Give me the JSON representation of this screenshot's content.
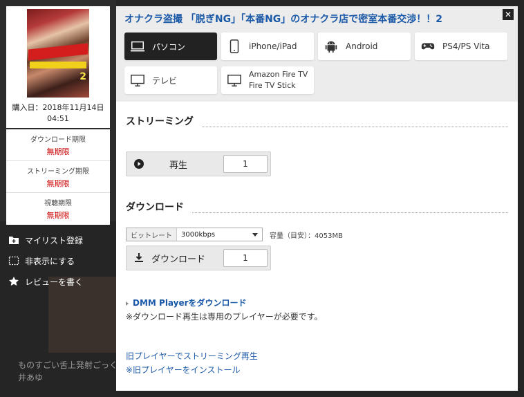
{
  "left": {
    "purchase_date": "購入日：2018年11月14日 04:51",
    "cover_number": "2",
    "periods": [
      {
        "label": "ダウンロード期限",
        "value": "無期限"
      },
      {
        "label": "ストリーミング期限",
        "value": "無期限"
      },
      {
        "label": "視聴期限",
        "value": "無期限"
      }
    ],
    "actions": [
      {
        "label": "マイリスト登録",
        "icon": "folder-plus-icon"
      },
      {
        "label": "非表示にする",
        "icon": "dotted-square-icon"
      },
      {
        "label": "レビューを書く",
        "icon": "star-icon"
      }
    ],
    "bg_text_1": "ものすごい舌上発射ごっくん",
    "bg_text_2": "井あゆ"
  },
  "modal": {
    "title": "オナクラ盗撮 「脱ぎNG」「本番NG」のオナクラ店で密室本番交渉！！2",
    "close_label": "✕",
    "devices": [
      {
        "label": "パソコン",
        "icon": "laptop-icon",
        "active": true
      },
      {
        "label": "iPhone/iPad",
        "icon": "phone-icon",
        "active": false
      },
      {
        "label": "Android",
        "icon": "android-icon",
        "active": false
      },
      {
        "label": "PS4/PS Vita",
        "icon": "gamepad-icon",
        "active": false
      },
      {
        "label": "テレビ",
        "icon": "tv-icon",
        "active": false
      },
      {
        "label": "Amazon Fire TV",
        "label2": "Fire TV Stick",
        "icon": "monitor-icon",
        "active": false
      }
    ],
    "streaming": {
      "heading": "ストリーミング",
      "play_label": "再生",
      "play_count": "1"
    },
    "download": {
      "heading": "ダウンロード",
      "bitrate_key": "ビットレート",
      "bitrate_value": "3000kbps",
      "capacity": "容量（目安）：4053MB",
      "download_label": "ダウンロード",
      "download_count": "1"
    },
    "player_link": "DMM Playerをダウンロード",
    "player_note": "※ダウンロード再生は専用のプレイヤーが必要です。",
    "old_player_link": "旧プレイヤーでストリーミング再生",
    "old_player_install": "※旧プレイヤーをインストール"
  }
}
